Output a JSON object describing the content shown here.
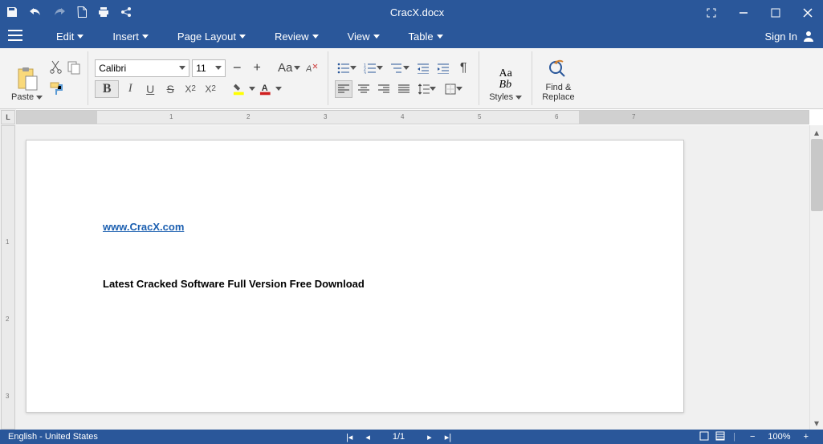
{
  "title": "CracX.docx",
  "menus": {
    "edit": "Edit",
    "insert": "Insert",
    "pageLayout": "Page Layout",
    "review": "Review",
    "view": "View",
    "table": "Table",
    "signIn": "Sign In"
  },
  "ribbon": {
    "pasteLabel": "Paste",
    "fontName": "Calibri",
    "fontSize": "11",
    "stylesLabel": "Styles",
    "findReplaceLabel": "Find &\nReplace",
    "AaBb1": "Aa",
    "AaBb2": "Bb"
  },
  "document": {
    "link": "www.CracX.com",
    "body": "Latest Cracked Software Full Version Free Download"
  },
  "status": {
    "lang": "English - United States",
    "page": "1/1",
    "zoom": "100%"
  }
}
